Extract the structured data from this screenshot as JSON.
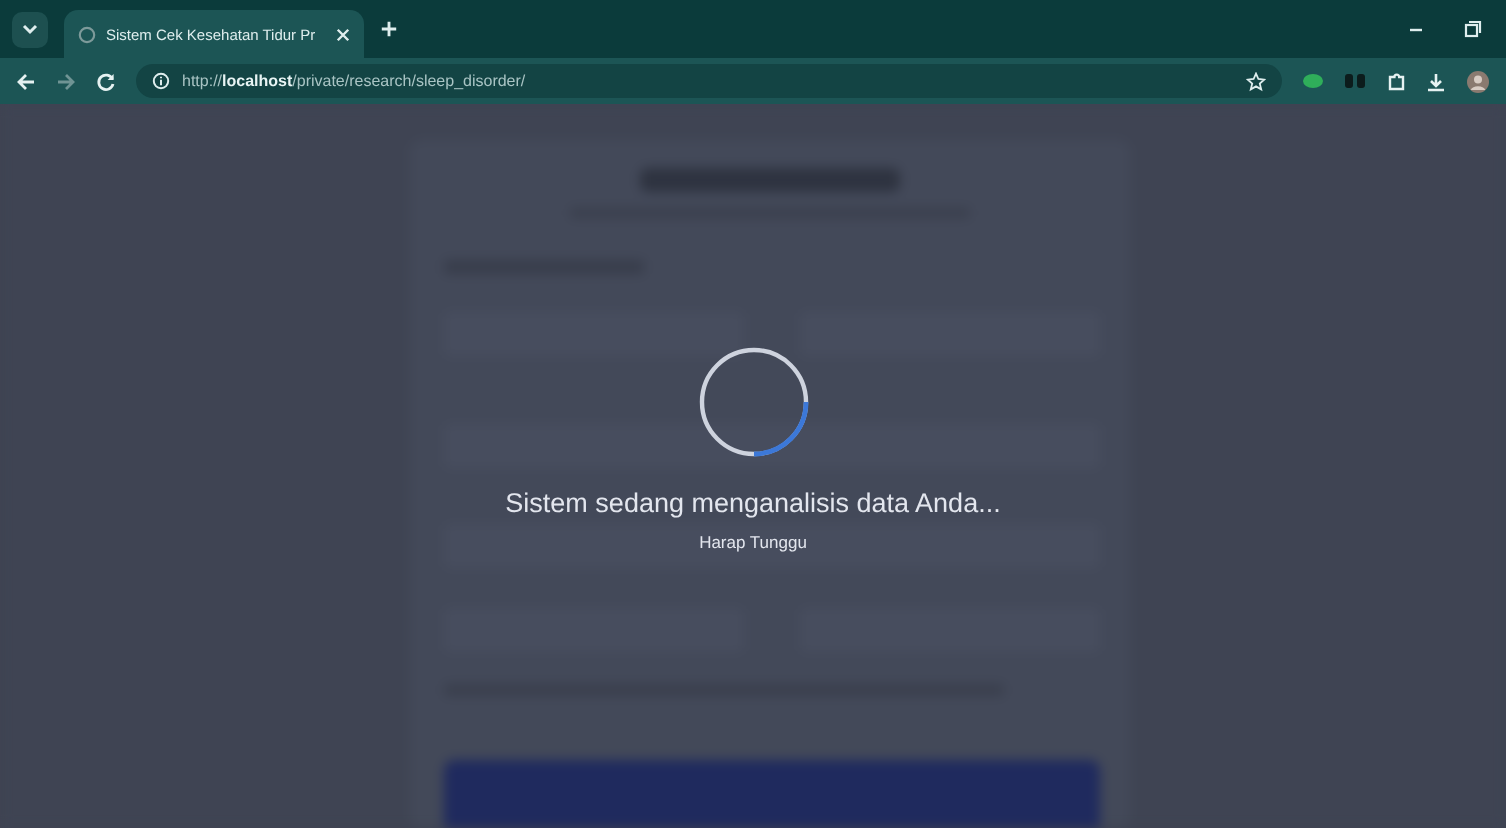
{
  "browser": {
    "tab": {
      "title": "Sistem Cek Kesehatan Tidur Pr",
      "selected": true
    },
    "url": "http://**localhost**/private/research/sleep_disorder/"
  },
  "loading": {
    "message": "Sistem sedang menganalisis data Anda...",
    "subtitle": "Harap Tunggu"
  }
}
